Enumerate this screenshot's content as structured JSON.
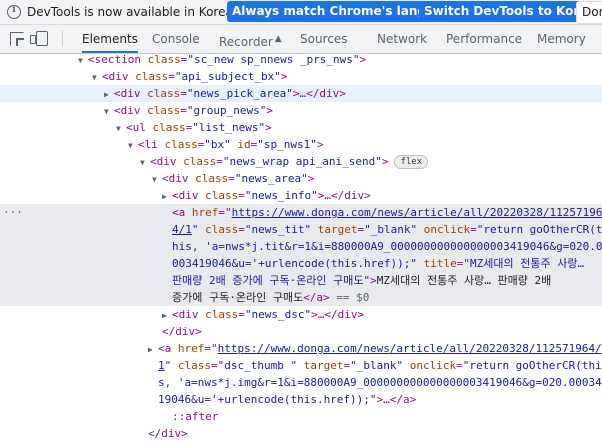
{
  "infobar": {
    "message": "DevTools is now available in Korean!",
    "btn_match": "Always match Chrome's language",
    "btn_switch": "Switch DevTools to Korean",
    "btn_dont": "Don"
  },
  "tabs": [
    "Elements",
    "Console",
    "Recorder",
    "Sources",
    "Network",
    "Performance",
    "Memory"
  ],
  "tree": {
    "r1_tag": "<section",
    "r1_attr": "class",
    "r1_val": "\"sc_new sp_nnews _prs_nws\"",
    "r1_close": ">",
    "r2_open": "<div",
    "r2_attr": "class",
    "r2_val": "\"api_subject_bx\"",
    "r2_close": ">",
    "r3_open": "<div",
    "r3_attr": "class",
    "r3_val": "\"news_pick_area\"",
    "r3_close": ">…</div>",
    "r4_open": "<div",
    "r4_attr": "class",
    "r4_val": "\"group_news\"",
    "r4_close": ">",
    "r5_open": "<ul",
    "r5_attr": "class",
    "r5_val": "\"list_news\"",
    "r5_close": ">",
    "r6_open": "<li",
    "r6_attr1": "class",
    "r6_val1": "\"bx\"",
    "r6_attr2": "id",
    "r6_val2": "\"sp_nws1\"",
    "r6_close": ">",
    "r7_open": "<div",
    "r7_attr": "class",
    "r7_val": "\"news_wrap api_ani_send\"",
    "r7_close": ">",
    "r7_badge": "flex",
    "r8_open": "<div",
    "r8_attr": "class",
    "r8_val": "\"news_area\"",
    "r8_close": ">",
    "r9_open": "<div",
    "r9_attr": "class",
    "r9_val": "\"news_info\"",
    "r9_close": ">…</div>",
    "a1_l1_open": "<a",
    "a1_l1_attr": "href",
    "a1_l1_link": "https://www.donga.com/news/article/all/20220328/11257196",
    "a1_l2_link": "4/1",
    "a1_l2_rest_attr1": "class",
    "a1_l2_rest_val1": "\"news_tit\"",
    "a1_l2_rest_attr2": "target",
    "a1_l2_rest_val2": "\"_blank\"",
    "a1_l2_rest_attr3": "onclick",
    "a1_l2_rest_val3": "\"return goOtherCR(t",
    "a1_l3": "his, 'a=nws*j.tit&r=1&i=880000A9_000000000000000003419046&g=020.0",
    "a1_l4_val": "003419046&u='+urlencode(this.href));\"",
    "a1_l4_attr": "title",
    "a1_l4_val2": "\"MZ세대의 전통주 사랑… ",
    "a1_l5_val": "판매량 2배 증가에 구독·온라인 구매도\"",
    "a1_l5_gt": ">",
    "a1_l5_text": "MZ세대의 전통주 사랑… 판매량 2배",
    "a1_l6_text": "증가에 구독·온라인 구매도",
    "a1_l6_close": "</a>",
    "a1_l6_sel": " == $0",
    "r15_open": "<div",
    "r15_attr": "class",
    "r15_val": "\"news_dsc\"",
    "r15_close": ">…</div>",
    "r16": "</div>",
    "a2_l1_open": "<a",
    "a2_l1_attr": "href",
    "a2_l1_link": "https://www.donga.com/news/article/all/20220328/112571964/",
    "a2_l2_link": "1",
    "a2_l2_attr1": "class",
    "a2_l2_val1": "\"dsc_thumb \"",
    "a2_l2_attr2": "target",
    "a2_l2_val2": "\"_blank\"",
    "a2_l2_attr3": "onclick",
    "a2_l2_val3": "\"return goOtherCR(this",
    "a2_l3": "s, 'a=nws*j.img&r=1&i=880000A9_000000000000000003419046&g=020.00034",
    "a2_l4_val": "19046&u='+urlencode(this.href));\"",
    "a2_l4_close": ">…</a>",
    "after": "::after",
    "r21": "</div>"
  }
}
